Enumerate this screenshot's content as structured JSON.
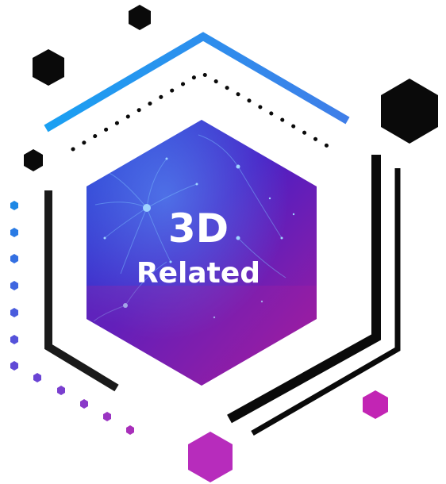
{
  "title": {
    "line1": "3D",
    "line2": "Related"
  },
  "colors": {
    "blue_accent": "#1e9bf0",
    "black": "#0a0a0a",
    "magenta": "#c02ab8",
    "hex_gradient_top": "#2a3fd8",
    "hex_gradient_mid": "#5a1ec0",
    "hex_gradient_bottom": "#a01a9a"
  },
  "decoration": {
    "center_image": "abstract-neural-network-particles",
    "shapes": [
      "black-hexagon",
      "blue-chevron-line",
      "dotted-line",
      "magenta-hexagon"
    ]
  }
}
